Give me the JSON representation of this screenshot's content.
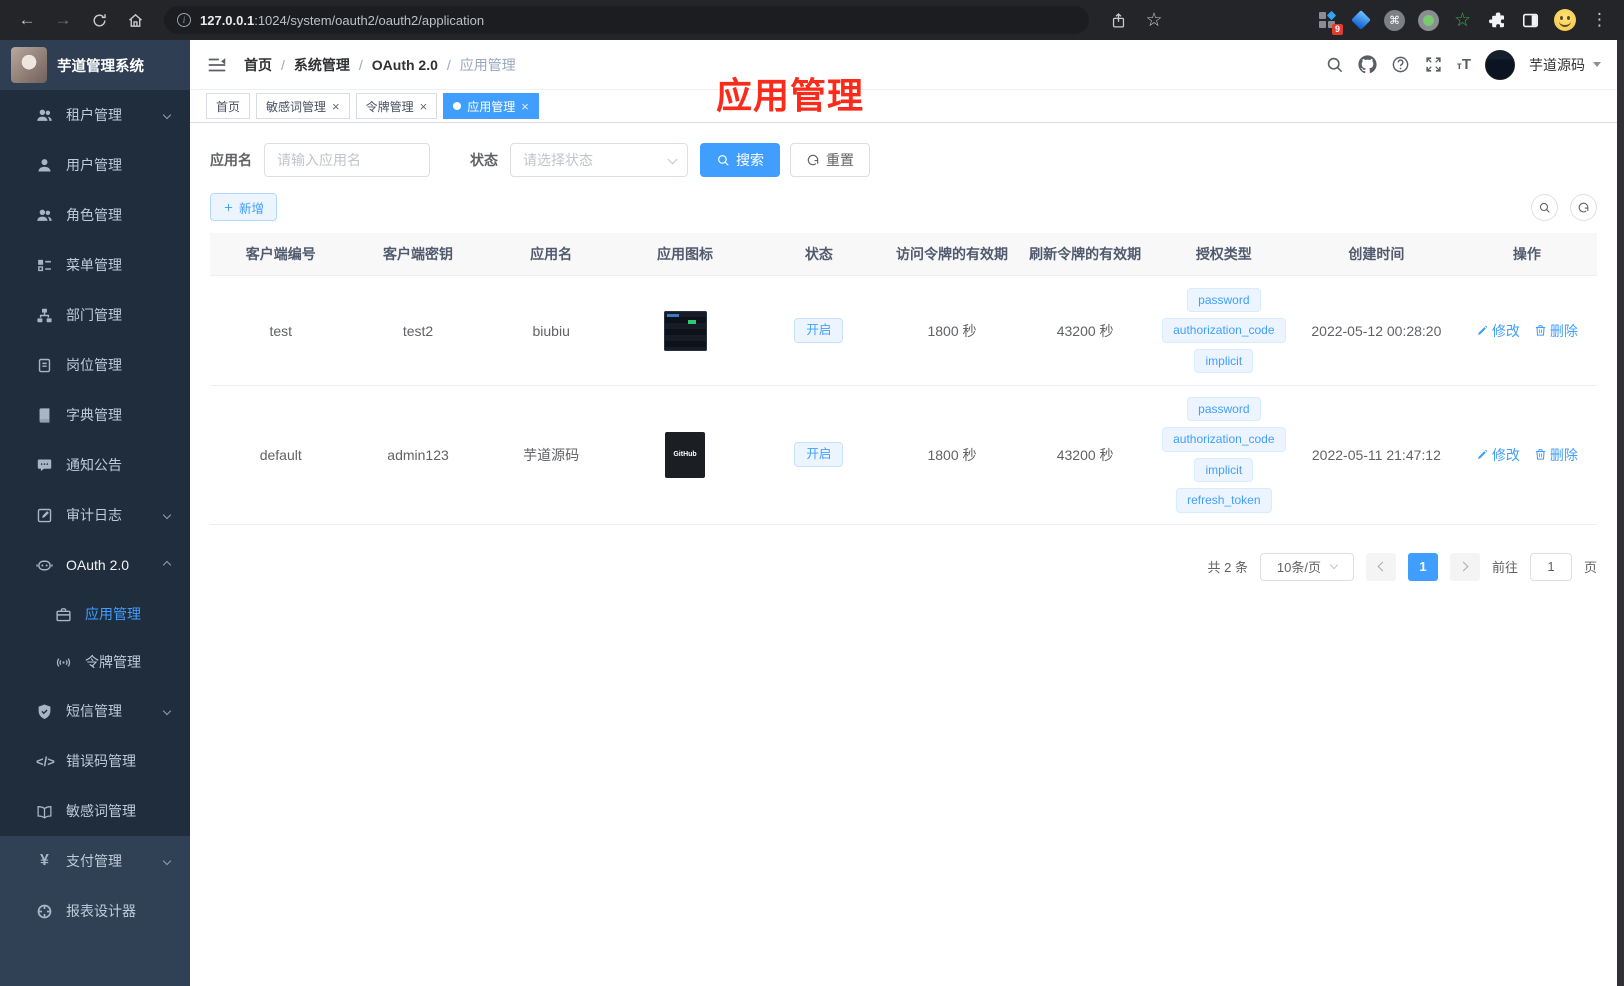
{
  "browser": {
    "url_host": "127.0.0.1",
    "url_path": ":1024/system/oauth2/oauth2/application",
    "ext_badge": "9"
  },
  "sidebar": {
    "title": "芋道管理系统",
    "items": [
      {
        "label": "租户管理"
      },
      {
        "label": "用户管理"
      },
      {
        "label": "角色管理"
      },
      {
        "label": "菜单管理"
      },
      {
        "label": "部门管理"
      },
      {
        "label": "岗位管理"
      },
      {
        "label": "字典管理"
      },
      {
        "label": "通知公告"
      },
      {
        "label": "审计日志"
      },
      {
        "label": "OAuth 2.0"
      },
      {
        "label": "应用管理"
      },
      {
        "label": "令牌管理"
      },
      {
        "label": "短信管理"
      },
      {
        "label": "错误码管理"
      },
      {
        "label": "敏感词管理"
      },
      {
        "label": "支付管理"
      },
      {
        "label": "报表设计器"
      }
    ]
  },
  "navbar": {
    "breadcrumb": [
      "首页",
      "系统管理",
      "OAuth 2.0",
      "应用管理"
    ],
    "username": "芋道源码"
  },
  "tabs": [
    {
      "label": "首页"
    },
    {
      "label": "敏感词管理"
    },
    {
      "label": "令牌管理"
    },
    {
      "label": "应用管理"
    }
  ],
  "annotation": "应用管理",
  "filters": {
    "name_label": "应用名",
    "name_placeholder": "请输入应用名",
    "status_label": "状态",
    "status_placeholder": "请选择状态",
    "search_label": "搜索",
    "reset_label": "重置"
  },
  "toolbar": {
    "add_label": "新增"
  },
  "table": {
    "headers": [
      "客户端编号",
      "客户端密钥",
      "应用名",
      "应用图标",
      "状态",
      "访问令牌的有效期",
      "刷新令牌的有效期",
      "授权类型",
      "创建时间",
      "操作"
    ],
    "actions": {
      "edit": "修改",
      "delete": "删除"
    },
    "rows": [
      {
        "client_id": "test",
        "client_secret": "test2",
        "app_name": "biubiu",
        "icon_text": "",
        "status": "开启",
        "access_token_validity": "1800 秒",
        "refresh_token_validity": "43200 秒",
        "grant_types": [
          "password",
          "authorization_code",
          "implicit"
        ],
        "create_time": "2022-05-12 00:28:20"
      },
      {
        "client_id": "default",
        "client_secret": "admin123",
        "app_name": "芋道源码",
        "icon_text": "GitHub",
        "status": "开启",
        "access_token_validity": "1800 秒",
        "refresh_token_validity": "43200 秒",
        "grant_types": [
          "password",
          "authorization_code",
          "implicit",
          "refresh_token"
        ],
        "create_time": "2022-05-11 21:47:12"
      }
    ]
  },
  "pagination": {
    "total": "共 2 条",
    "page_size": "10条/页",
    "current_page": "1",
    "goto_label": "前往",
    "goto_value": "1",
    "page_unit": "页"
  },
  "colors": {
    "accent": "#409eff",
    "annotation_red": "#fb2b1b",
    "sidebar_bg": "#304156",
    "submenu_bg": "#1f2d3d"
  }
}
